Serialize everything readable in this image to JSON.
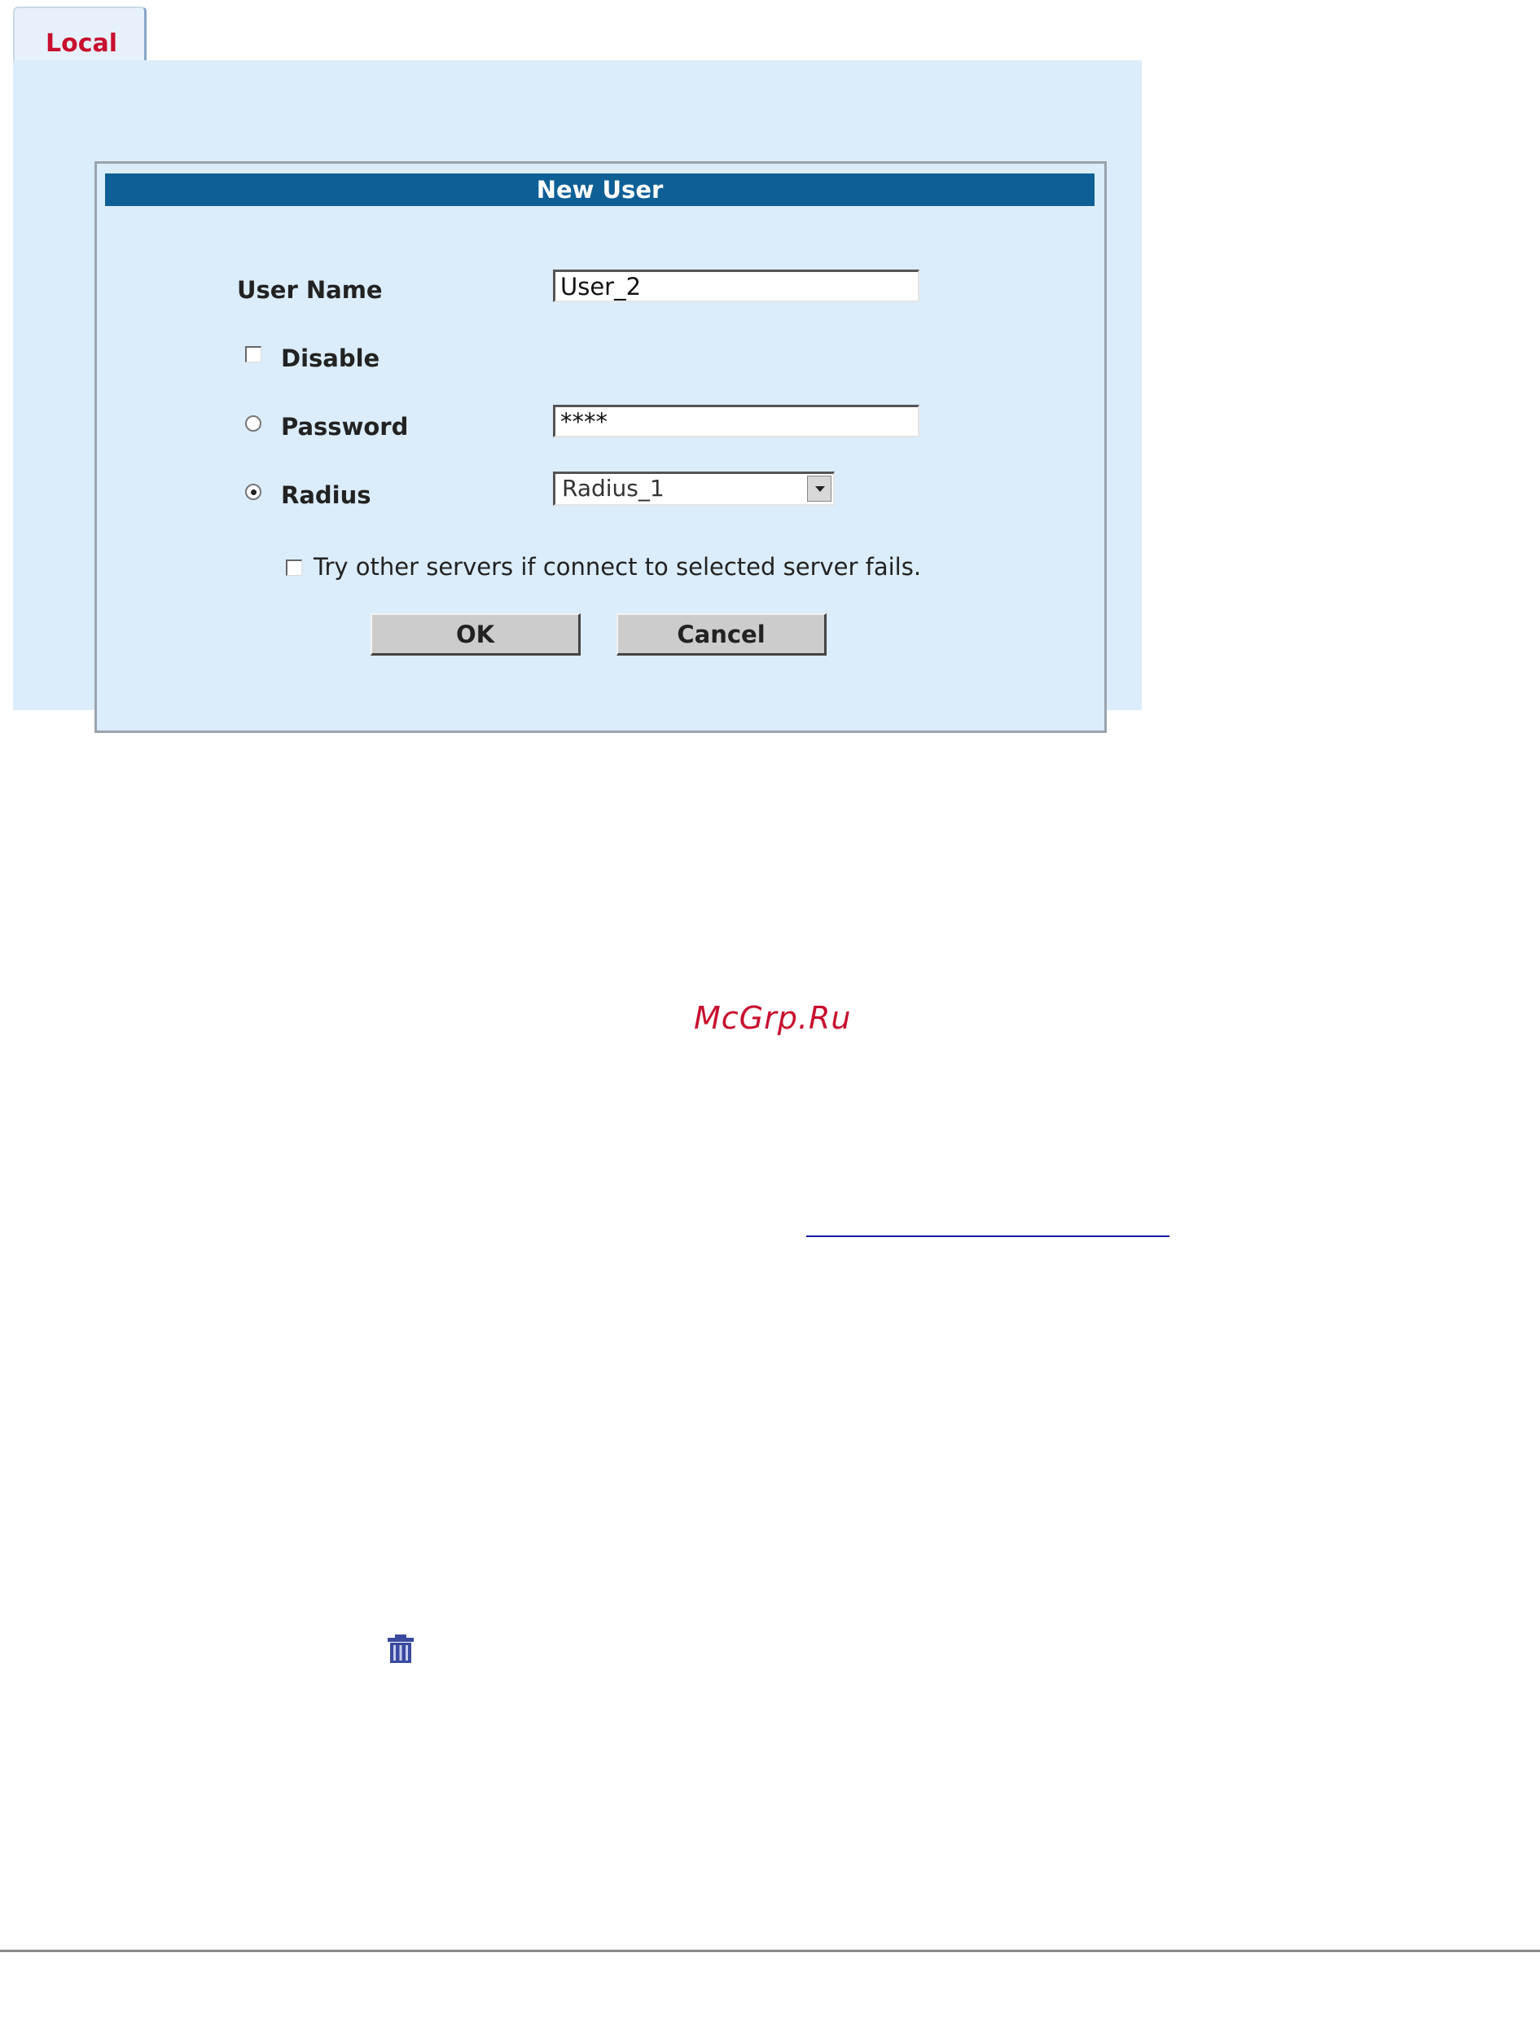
{
  "tab": {
    "label": "Local"
  },
  "dialog": {
    "title": "New User",
    "user_name_label": "User Name",
    "user_name_value": "User_2",
    "disable_label": "Disable",
    "password_label": "Password",
    "password_value": "****",
    "radius_label": "Radius",
    "radius_selected": "Radius_1",
    "try_other_label": "Try other servers if connect to selected server fails.",
    "ok_label": "OK",
    "cancel_label": "Cancel",
    "auth_mode": "radius",
    "disable_checked": false,
    "try_other_checked": false
  },
  "watermark": "McGrp.Ru",
  "icons": {
    "delete": "trash-icon"
  },
  "colors": {
    "title_bar": "#0e5f96",
    "panel_bg": "#dbecfa",
    "tab_label": "#c8102e",
    "watermark": "#c8102e"
  }
}
